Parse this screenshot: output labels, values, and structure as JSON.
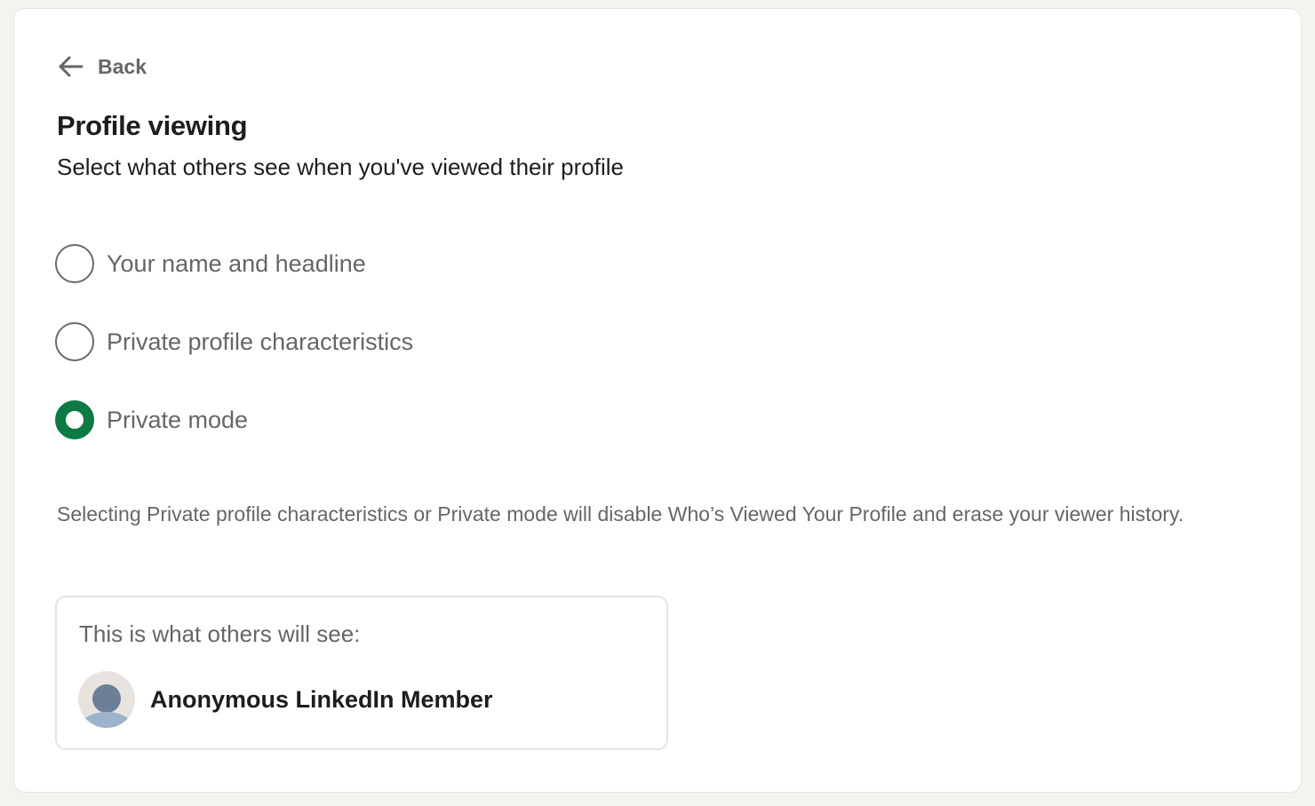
{
  "back": {
    "label": "Back"
  },
  "page": {
    "title": "Profile viewing",
    "subtitle": "Select what others see when you've viewed their profile"
  },
  "options": [
    {
      "label": "Your name and headline",
      "selected": false
    },
    {
      "label": "Private profile characteristics",
      "selected": false
    },
    {
      "label": "Private mode",
      "selected": true
    }
  ],
  "note": "Selecting Private profile characteristics or Private mode will disable Who’s Viewed Your Profile and erase your viewer history.",
  "preview": {
    "heading": "This is what others will see:",
    "member_name": "Anonymous LinkedIn Member",
    "avatar_icon": "anonymous-avatar-icon"
  },
  "colors": {
    "accent": "#0c7a43",
    "text_primary": "#1d1d1d",
    "text_secondary": "#666666",
    "page_background": "#f4f3f0"
  }
}
